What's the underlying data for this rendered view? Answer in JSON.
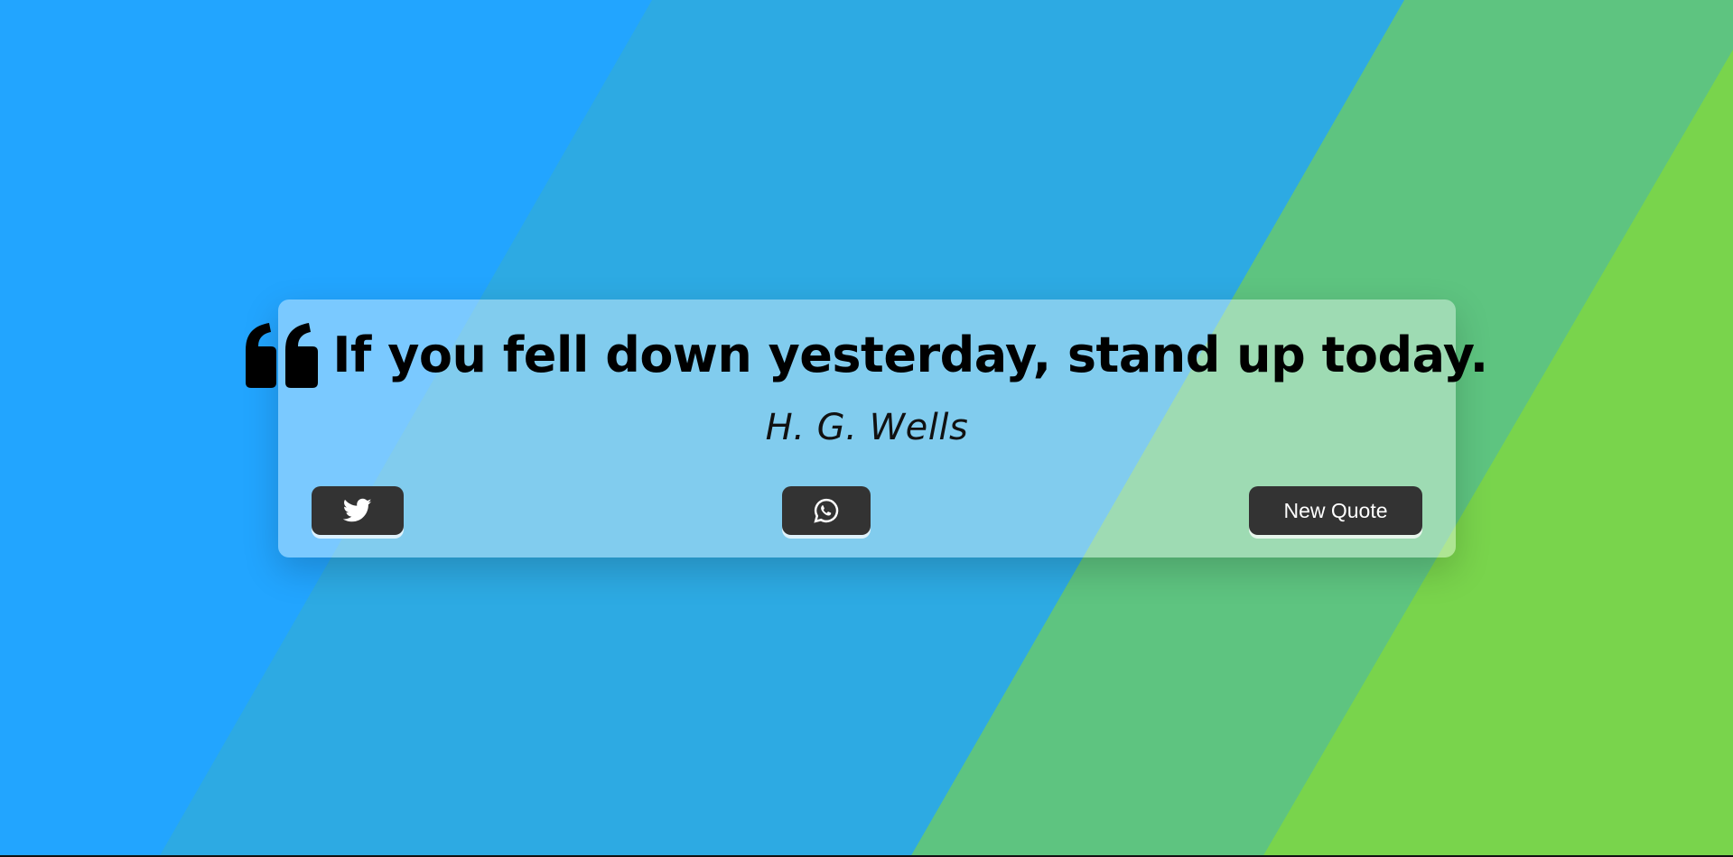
{
  "quote": {
    "text": "If you fell down yesterday, stand up today.",
    "author": "H. G. Wells"
  },
  "buttons": {
    "twitter_icon": "twitter-icon",
    "whatsapp_icon": "whatsapp-icon",
    "new_quote_label": "New Quote"
  },
  "colors": {
    "background_blue": "#22A5FF",
    "mid_blue": "#2DAAE3",
    "green": "#5EC480",
    "bright_green": "#79D44C",
    "button": "#333333",
    "button_text": "#FFFFFF"
  }
}
